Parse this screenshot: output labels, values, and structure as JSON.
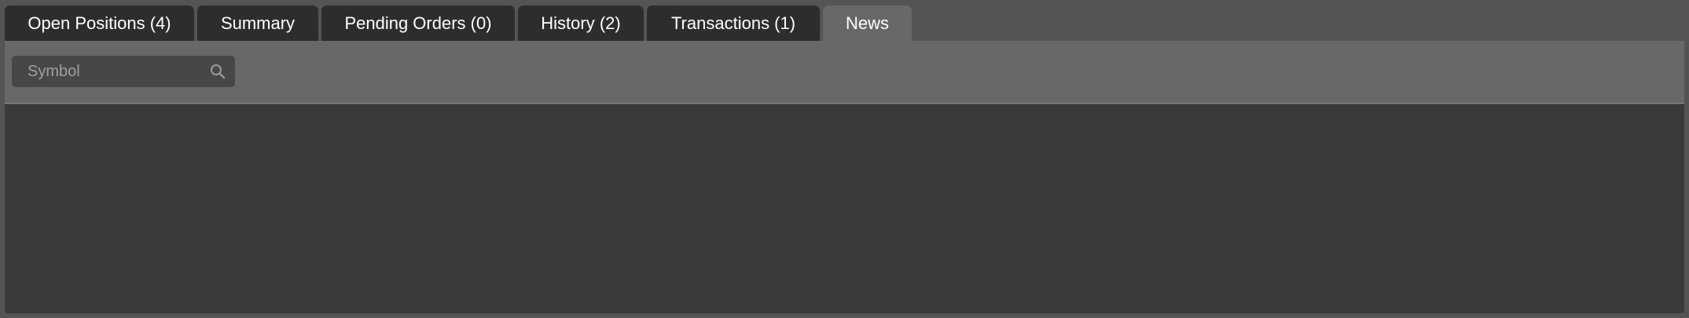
{
  "tabs": [
    {
      "label": "Open Positions (4)",
      "active": false
    },
    {
      "label": "Summary",
      "active": false
    },
    {
      "label": "Pending Orders (0)",
      "active": false
    },
    {
      "label": "History (2)",
      "active": false
    },
    {
      "label": "Transactions (1)",
      "active": false
    },
    {
      "label": "News",
      "active": true
    }
  ],
  "search": {
    "placeholder": "Symbol",
    "value": "",
    "icon": "search-icon"
  },
  "colors": {
    "background": "#545454",
    "tab_inactive": "#2d2d2d",
    "tab_active": "#686868",
    "toolbar": "#686868",
    "search_field": "#474747",
    "content_panel": "#3a3a3a",
    "text": "#ffffff"
  }
}
